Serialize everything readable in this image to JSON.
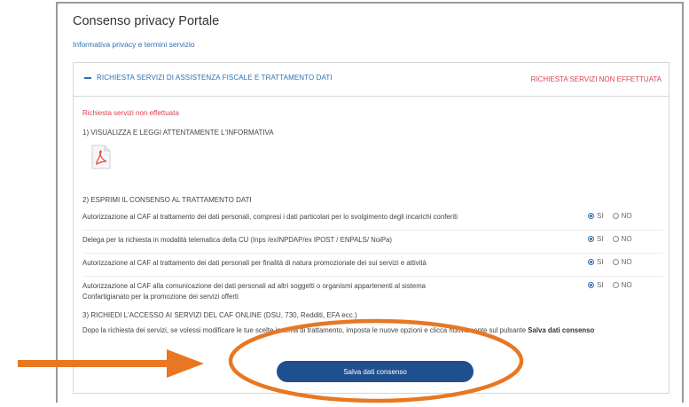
{
  "page": {
    "title": "Consenso privacy Portale",
    "privacy_link": "Informativa privacy e termini servizio"
  },
  "panel": {
    "heading": "RICHIESTA SERVIZI DI ASSISTENZA FISCALE E TRATTAMENTO DATI",
    "status": "RICHIESTA SERVIZI NON EFFETTUATA",
    "error_message": "Richiesta servizi non effettuata",
    "step1": "1) VISUALIZZA E LEGGI ATTENTAMENTE L'INFORMATIVA",
    "step2": "2) ESPRIMI IL CONSENSO AL TRATTAMENTO DATI",
    "step3": "3) RICHIEDI L'ACCESSO AI SERVIZI DEL CAF ONLINE (DSU, 730, Redditi, EFA ecc.)",
    "yes_label": "SI",
    "no_label": "NO",
    "consents": [
      {
        "text": "Autorizzazione al CAF al trattamento dei dati personali, compresi i dati particolari per lo svolgimento degli incarichi conferiti",
        "selected": "SI"
      },
      {
        "text": "Delega per la richiesta in modalità telematica della CU (Inps /exINPDAP/ex IPOST / ENPALS/ NoiPa)",
        "selected": "SI"
      },
      {
        "text": "Autorizzazione al CAF al trattamento dei dati personali per finalità di natura promozionale dei sui servizi e attività",
        "selected": "SI"
      },
      {
        "text": "Autorizzazione al CAF alla comunicazione dei dati personali ad altri soggetti o organismi appartenenti al sistema Confartigianato per la promozione dei servizi offerti",
        "selected": "SI"
      }
    ],
    "note_text": "Dopo la richiesta dei servizi, se volessi modificare le tue scelte in tema di trattamento, imposta le nuove opzioni e clicca nuovamente sul pulsante ",
    "note_bold": "Salva dati consenso",
    "save_button": "Salva dati consenso"
  },
  "colors": {
    "link": "#2f6fb0",
    "error": "#d9434e",
    "button": "#1f4f8f",
    "annotation": "#e87722"
  },
  "icons": {
    "collapse": "minus-icon",
    "document": "pdf-icon"
  }
}
